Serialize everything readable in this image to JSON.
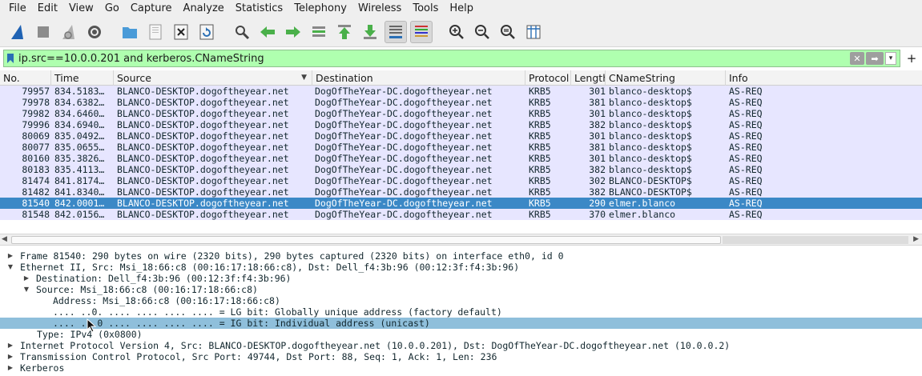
{
  "menu": [
    "File",
    "Edit",
    "View",
    "Go",
    "Capture",
    "Analyze",
    "Statistics",
    "Telephony",
    "Wireless",
    "Tools",
    "Help"
  ],
  "toolbar": {
    "icons": [
      "shark-fin-start-icon",
      "stop-square-icon",
      "restart-fin-icon",
      "gear-options-icon",
      "open-folder-icon",
      "save-file-icon",
      "close-file-icon",
      "reload-icon",
      "find-packet-icon",
      "go-back-icon",
      "go-forward-icon",
      "go-to-packet-icon",
      "first-packet-icon",
      "last-packet-icon",
      "auto-scroll-icon",
      "colorize-icon",
      "zoom-in-icon",
      "zoom-out-icon",
      "zoom-reset-icon",
      "resize-columns-icon"
    ],
    "colors": {
      "fin": "#1f62b3",
      "arrow": "#4ab04a",
      "folder": "#4a9bd8"
    }
  },
  "filter": {
    "value": "ip.src==10.0.0.201 and kerberos.CNameString",
    "bg_color": "#afffaf",
    "plus": "+"
  },
  "packet_list": {
    "columns": [
      "No.",
      "Time",
      "Source",
      "Destination",
      "Protocol",
      "Length",
      "CNameString",
      "Info"
    ],
    "rows": [
      {
        "no": "79957",
        "time": "834.5183…",
        "src": "BLANCO-DESKTOP.dogoftheyear.net",
        "dst": "DogOfTheYear-DC.dogoftheyear.net",
        "proto": "KRB5",
        "len": "301",
        "cname": "blanco-desktop$",
        "info": "AS-REQ"
      },
      {
        "no": "79978",
        "time": "834.6382…",
        "src": "BLANCO-DESKTOP.dogoftheyear.net",
        "dst": "DogOfTheYear-DC.dogoftheyear.net",
        "proto": "KRB5",
        "len": "381",
        "cname": "blanco-desktop$",
        "info": "AS-REQ"
      },
      {
        "no": "79982",
        "time": "834.6460…",
        "src": "BLANCO-DESKTOP.dogoftheyear.net",
        "dst": "DogOfTheYear-DC.dogoftheyear.net",
        "proto": "KRB5",
        "len": "301",
        "cname": "blanco-desktop$",
        "info": "AS-REQ"
      },
      {
        "no": "79996",
        "time": "834.6940…",
        "src": "BLANCO-DESKTOP.dogoftheyear.net",
        "dst": "DogOfTheYear-DC.dogoftheyear.net",
        "proto": "KRB5",
        "len": "382",
        "cname": "blanco-desktop$",
        "info": "AS-REQ"
      },
      {
        "no": "80069",
        "time": "835.0492…",
        "src": "BLANCO-DESKTOP.dogoftheyear.net",
        "dst": "DogOfTheYear-DC.dogoftheyear.net",
        "proto": "KRB5",
        "len": "301",
        "cname": "blanco-desktop$",
        "info": "AS-REQ"
      },
      {
        "no": "80077",
        "time": "835.0655…",
        "src": "BLANCO-DESKTOP.dogoftheyear.net",
        "dst": "DogOfTheYear-DC.dogoftheyear.net",
        "proto": "KRB5",
        "len": "381",
        "cname": "blanco-desktop$",
        "info": "AS-REQ"
      },
      {
        "no": "80160",
        "time": "835.3826…",
        "src": "BLANCO-DESKTOP.dogoftheyear.net",
        "dst": "DogOfTheYear-DC.dogoftheyear.net",
        "proto": "KRB5",
        "len": "301",
        "cname": "blanco-desktop$",
        "info": "AS-REQ"
      },
      {
        "no": "80183",
        "time": "835.4113…",
        "src": "BLANCO-DESKTOP.dogoftheyear.net",
        "dst": "DogOfTheYear-DC.dogoftheyear.net",
        "proto": "KRB5",
        "len": "382",
        "cname": "blanco-desktop$",
        "info": "AS-REQ"
      },
      {
        "no": "81474",
        "time": "841.8174…",
        "src": "BLANCO-DESKTOP.dogoftheyear.net",
        "dst": "DogOfTheYear-DC.dogoftheyear.net",
        "proto": "KRB5",
        "len": "302",
        "cname": "BLANCO-DESKTOP$",
        "info": "AS-REQ"
      },
      {
        "no": "81482",
        "time": "841.8340…",
        "src": "BLANCO-DESKTOP.dogoftheyear.net",
        "dst": "DogOfTheYear-DC.dogoftheyear.net",
        "proto": "KRB5",
        "len": "382",
        "cname": "BLANCO-DESKTOP$",
        "info": "AS-REQ"
      },
      {
        "no": "81540",
        "time": "842.0001…",
        "src": "BLANCO-DESKTOP.dogoftheyear.net",
        "dst": "DogOfTheYear-DC.dogoftheyear.net",
        "proto": "KRB5",
        "len": "290",
        "cname": "elmer.blanco",
        "info": "AS-REQ",
        "selected": true
      },
      {
        "no": "81548",
        "time": "842.0156…",
        "src": "BLANCO-DESKTOP.dogoftheyear.net",
        "dst": "DogOfTheYear-DC.dogoftheyear.net",
        "proto": "KRB5",
        "len": "370",
        "cname": "elmer.blanco",
        "info": "AS-REQ"
      }
    ],
    "row_color": "#e7e6ff",
    "selected_color": "#3b88c6"
  },
  "details": [
    {
      "arrow": "right",
      "indent": 0,
      "text": "Frame 81540: 290 bytes on wire (2320 bits), 290 bytes captured (2320 bits) on interface eth0, id 0"
    },
    {
      "arrow": "down",
      "indent": 0,
      "text": "Ethernet II, Src: Msi_18:66:c8 (00:16:17:18:66:c8), Dst: Dell_f4:3b:96 (00:12:3f:f4:3b:96)"
    },
    {
      "arrow": "right",
      "indent": 1,
      "text": "Destination: Dell_f4:3b:96 (00:12:3f:f4:3b:96)"
    },
    {
      "arrow": "down",
      "indent": 1,
      "text": "Source: Msi_18:66:c8 (00:16:17:18:66:c8)"
    },
    {
      "arrow": "",
      "indent": 2,
      "text": "Address: Msi_18:66:c8 (00:16:17:18:66:c8)"
    },
    {
      "arrow": "",
      "indent": 2,
      "text": ".... ..0. .... .... .... .... = LG bit: Globally unique address (factory default)"
    },
    {
      "arrow": "",
      "indent": 2,
      "text": ".... ...0 .... .... .... .... = IG bit: Individual address (unicast)",
      "highlight": true
    },
    {
      "arrow": "",
      "indent": 1,
      "text": "Type: IPv4 (0x0800)"
    },
    {
      "arrow": "right",
      "indent": 0,
      "text": "Internet Protocol Version 4, Src: BLANCO-DESKTOP.dogoftheyear.net (10.0.0.201), Dst: DogOfTheYear-DC.dogoftheyear.net (10.0.0.2)"
    },
    {
      "arrow": "right",
      "indent": 0,
      "text": "Transmission Control Protocol, Src Port: 49744, Dst Port: 88, Seq: 1, Ack: 1, Len: 236"
    },
    {
      "arrow": "right",
      "indent": 0,
      "text": "Kerberos"
    }
  ]
}
